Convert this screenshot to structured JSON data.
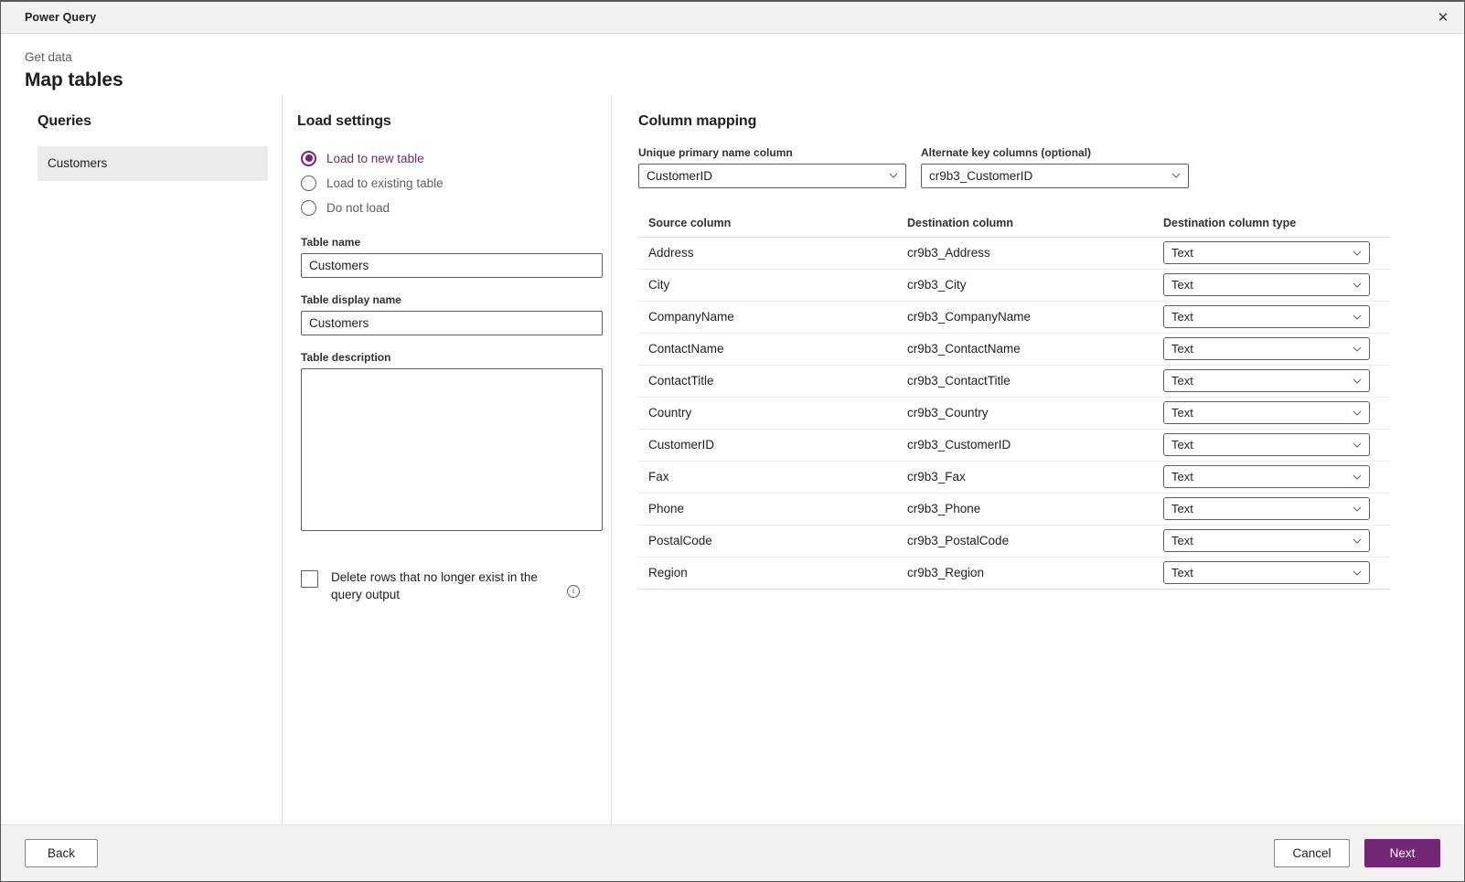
{
  "window": {
    "title": "Power Query",
    "close_icon": "close-icon",
    "close_glyph": "✕"
  },
  "header": {
    "breadcrumb": "Get data",
    "title": "Map tables"
  },
  "queries": {
    "section_title": "Queries",
    "items": [
      {
        "label": "Customers",
        "selected": true
      }
    ]
  },
  "load_settings": {
    "section_title": "Load settings",
    "options": [
      {
        "label": "Load to new table",
        "checked": true
      },
      {
        "label": "Load to existing table",
        "checked": false
      },
      {
        "label": "Do not load",
        "checked": false
      }
    ],
    "table_name": {
      "label": "Table name",
      "value": "Customers",
      "placeholder": ""
    },
    "table_display_name": {
      "label": "Table display name",
      "value": "Customers",
      "placeholder": ""
    },
    "table_description": {
      "label": "Table description",
      "value": "",
      "placeholder": ""
    },
    "delete_rows": {
      "label": "Delete rows that no longer exist in the query output",
      "checked": false,
      "info_icon": "info-icon",
      "info_glyph": "i"
    }
  },
  "column_mapping": {
    "section_title": "Column mapping",
    "primary_name_column": {
      "label": "Unique primary name column",
      "value": "CustomerID"
    },
    "alternate_key_columns": {
      "label": "Alternate key columns (optional)",
      "value": "cr9b3_CustomerID"
    },
    "table_headers": {
      "source": "Source column",
      "destination": "Destination column",
      "destination_type": "Destination column type"
    },
    "rows": [
      {
        "source": "Address",
        "destination": "cr9b3_Address",
        "type": "Text"
      },
      {
        "source": "City",
        "destination": "cr9b3_City",
        "type": "Text"
      },
      {
        "source": "CompanyName",
        "destination": "cr9b3_CompanyName",
        "type": "Text"
      },
      {
        "source": "ContactName",
        "destination": "cr9b3_ContactName",
        "type": "Text"
      },
      {
        "source": "ContactTitle",
        "destination": "cr9b3_ContactTitle",
        "type": "Text"
      },
      {
        "source": "Country",
        "destination": "cr9b3_Country",
        "type": "Text"
      },
      {
        "source": "CustomerID",
        "destination": "cr9b3_CustomerID",
        "type": "Text"
      },
      {
        "source": "Fax",
        "destination": "cr9b3_Fax",
        "type": "Text"
      },
      {
        "source": "Phone",
        "destination": "cr9b3_Phone",
        "type": "Text"
      },
      {
        "source": "PostalCode",
        "destination": "cr9b3_PostalCode",
        "type": "Text"
      },
      {
        "source": "Region",
        "destination": "cr9b3_Region",
        "type": "Text"
      }
    ]
  },
  "footer": {
    "back": "Back",
    "cancel": "Cancel",
    "next": "Next"
  },
  "colors": {
    "accent": "#742774",
    "titlebar_bg": "#f3f2f1",
    "selected_item_bg": "#edebe9",
    "divider": "#e1dfdd",
    "text": "#201f1e",
    "muted_text": "#605e5c"
  }
}
